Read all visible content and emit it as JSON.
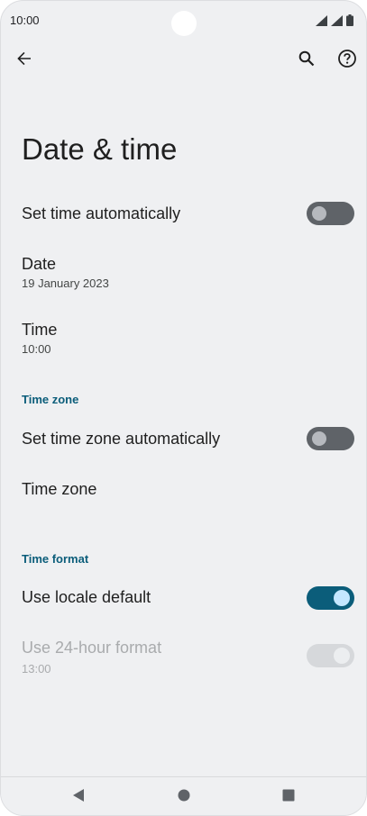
{
  "status_bar": {
    "time": "10:00"
  },
  "app_bar": {
    "back_icon": "arrow-back-icon",
    "search_icon": "search-icon",
    "help_icon": "help-icon"
  },
  "page": {
    "title": "Date & time"
  },
  "settings": {
    "set_time_auto": {
      "label": "Set time automatically",
      "enabled": false
    },
    "date": {
      "label": "Date",
      "value": "19 January 2023"
    },
    "time": {
      "label": "Time",
      "value": "10:00"
    },
    "time_zone_section": {
      "header": "Time zone"
    },
    "set_timezone_auto": {
      "label": "Set time zone automatically",
      "enabled": false
    },
    "time_zone": {
      "label": "Time zone"
    },
    "time_format_section": {
      "header": "Time format"
    },
    "use_locale_default": {
      "label": "Use locale default",
      "enabled": true
    },
    "use_24_hour": {
      "label": "Use 24-hour format",
      "value": "13:00",
      "enabled": true,
      "disabled": true
    }
  },
  "colors": {
    "accent": "#0b5d7a",
    "background": "#eff0f2"
  }
}
